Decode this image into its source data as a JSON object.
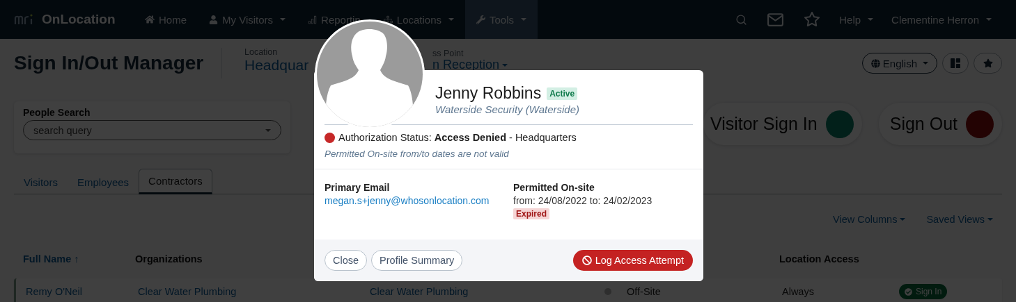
{
  "navbar": {
    "brand": "OnLocation",
    "items": [
      {
        "label": "Home",
        "dropdown": false,
        "selected": false
      },
      {
        "label": "My Visitors",
        "dropdown": true,
        "selected": false
      },
      {
        "label": "Reportin",
        "dropdown": false,
        "selected": false
      },
      {
        "label": "Locations",
        "dropdown": true,
        "selected": false
      },
      {
        "label": "Tools",
        "dropdown": true,
        "selected": true
      }
    ],
    "menus": [
      {
        "label": "Help"
      },
      {
        "label": "Clementine Herron"
      }
    ]
  },
  "header": {
    "title": "Sign In/Out Manager",
    "location": {
      "label": "Location",
      "value": "Headquar"
    },
    "access_point": {
      "label": "ss Point",
      "value": "n Reception"
    },
    "language": "English"
  },
  "people_search": {
    "label": "People Search",
    "placeholder": "search query"
  },
  "actions": [
    {
      "label": "Visitor Sign In",
      "color": "#02201a"
    },
    {
      "label": "Sign Out",
      "color": "#230303"
    }
  ],
  "tabs": [
    {
      "label": "Visitors",
      "selected": false
    },
    {
      "label": "Employees",
      "selected": false
    },
    {
      "label": "Contractors",
      "selected": true
    }
  ],
  "table_tools": [
    {
      "label": "View Columns"
    },
    {
      "label": "Saved Views"
    }
  ],
  "table": {
    "columns": [
      {
        "label": "Full Name",
        "sort_arrow": "↑",
        "sorted": true
      },
      {
        "label": "Organizations",
        "sorted": false
      },
      {},
      {},
      {},
      {
        "label": "Location Access",
        "sorted": false
      }
    ],
    "rows": [
      {
        "cells": [
          {
            "kind": "link",
            "text": "Remy O'Neil"
          },
          {
            "kind": "link",
            "text": "Clear Water Plumbing"
          },
          {
            "kind": "link",
            "text": "Clear Water Plumbing"
          },
          {
            "kind": "dot",
            "color": "#2e2e2e"
          },
          {
            "kind": "text",
            "text": "Off-Site"
          },
          {
            "kind": "text",
            "text": "Always"
          },
          {
            "kind": "button",
            "text": "Sign In"
          }
        ]
      }
    ]
  },
  "modal": {
    "name": "Jenny Robbins",
    "status_badge": "Active",
    "company": "Waterside Security (Waterside)",
    "authorization": {
      "text": "Authorization Status: **Access Denied** - Headquarters",
      "color": "#c62828"
    },
    "note": "Permitted On-site from/to dates are not valid",
    "details": [
      {
        "kind": "link",
        "label": "Primary Email",
        "value": "megan.s+jenny@whosonlocation.com"
      },
      {
        "kind": "text",
        "label": "Permitted On-site",
        "value": "from: 24/08/2022 to: 24/02/2023",
        "badge": "Expired"
      }
    ],
    "buttons": [
      {
        "kind": "outline",
        "label": "Close"
      },
      {
        "kind": "outline",
        "label": "Profile Summary"
      },
      {
        "kind": "danger",
        "label": "Log Access Attempt"
      }
    ]
  }
}
